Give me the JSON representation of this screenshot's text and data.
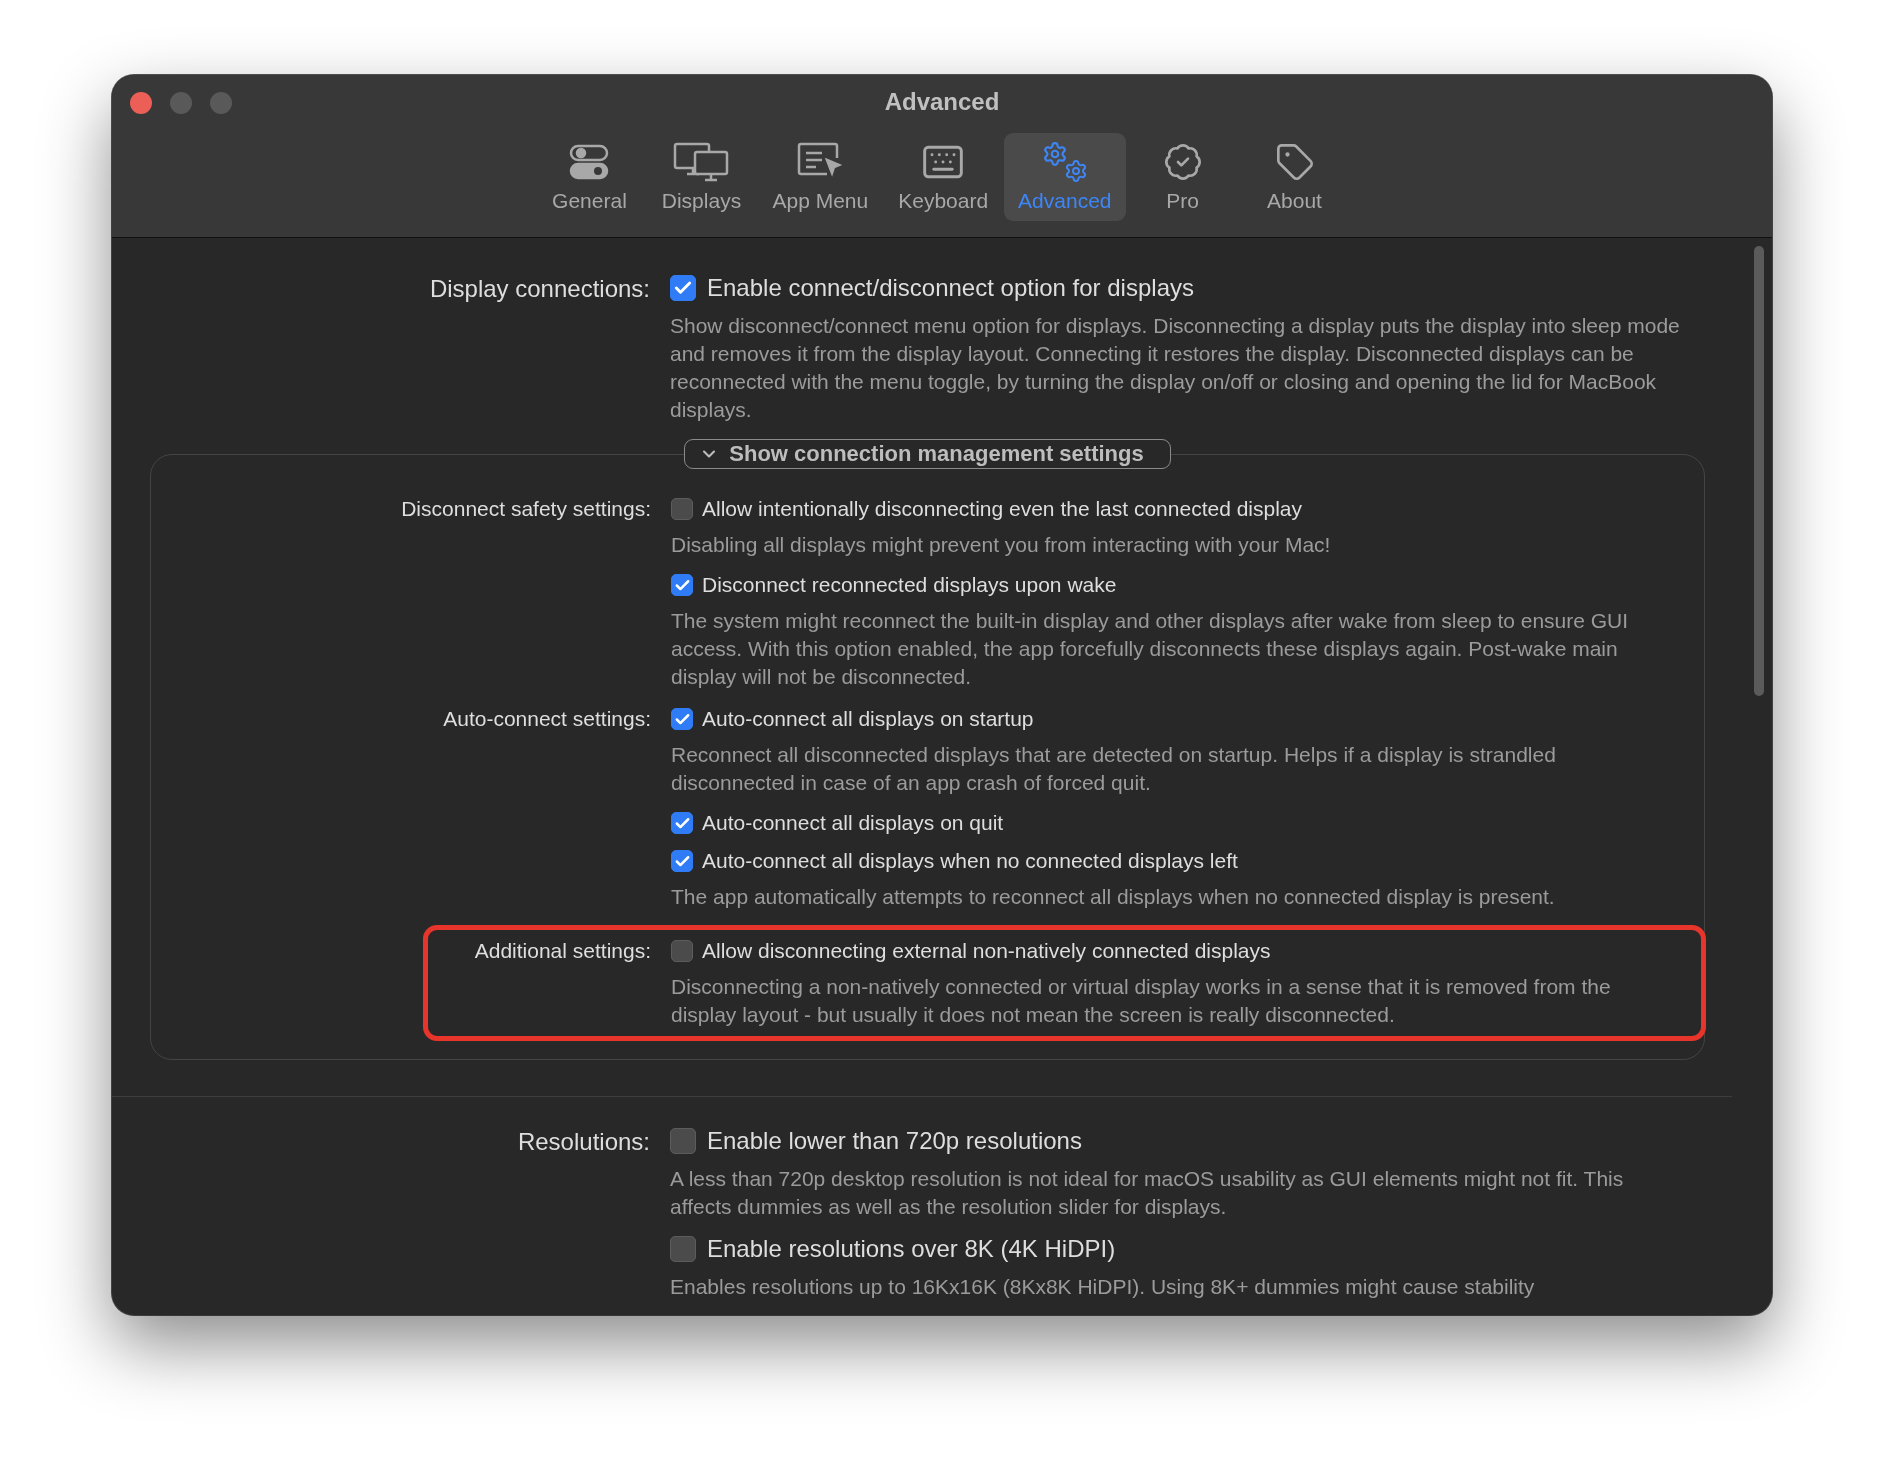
{
  "window": {
    "title": "Advanced"
  },
  "tabs": [
    {
      "label": "General",
      "kind": "toggles",
      "selected": false
    },
    {
      "label": "Displays",
      "kind": "displays",
      "selected": false
    },
    {
      "label": "App Menu",
      "kind": "menu",
      "selected": false
    },
    {
      "label": "Keyboard",
      "kind": "keyboard",
      "selected": false
    },
    {
      "label": "Advanced",
      "kind": "gears",
      "selected": true
    },
    {
      "label": "Pro",
      "kind": "badge",
      "selected": false
    },
    {
      "label": "About",
      "kind": "tag",
      "selected": false
    }
  ],
  "display_connections": {
    "label": "Display connections:",
    "options": [
      {
        "label": "Enable connect/disconnect option for displays",
        "checked": true,
        "description": "Show disconnect/connect menu option for displays. Disconnecting a display puts the display into sleep mode and removes it from the display layout. Connecting it restores the display. Disconnected displays can be reconnected with the menu toggle, by turning the display on/off or closing and opening the lid for MacBook displays."
      }
    ]
  },
  "connection_management": {
    "label": "Show connection management settings",
    "expanded": true,
    "groups": [
      {
        "label": "Disconnect safety settings:",
        "highlighted": false,
        "options": [
          {
            "label": "Allow intentionally disconnecting even the last connected display",
            "checked": false,
            "description": "Disabling all displays might prevent you from interacting with your Mac!"
          },
          {
            "label": "Disconnect reconnected displays upon wake",
            "checked": true,
            "description": "The system might reconnect the built-in display and other displays after wake from sleep to ensure GUI access. With this option enabled, the app forcefully disconnects these displays again. Post-wake main display will not be disconnected."
          }
        ]
      },
      {
        "label": "Auto-connect settings:",
        "highlighted": false,
        "options": [
          {
            "label": "Auto-connect all displays on startup",
            "checked": true,
            "description": "Reconnect all disconnected displays that are detected on startup. Helps if a display is strandled disconnected in case of an app crash of forced quit."
          },
          {
            "label": "Auto-connect all displays on quit",
            "checked": true
          },
          {
            "label": "Auto-connect all displays when no connected displays left",
            "checked": true,
            "description": "The app automatically attempts to reconnect all displays when no connected display is present."
          }
        ]
      },
      {
        "label": "Additional settings:",
        "highlighted": true,
        "options": [
          {
            "label": "Allow disconnecting external non-natively connected displays",
            "checked": false,
            "description": "Disconnecting a non-natively connected or virtual display works in a sense that it is removed from the display layout - but usually it does not mean the screen is really disconnected."
          }
        ]
      }
    ]
  },
  "resolutions": {
    "label": "Resolutions:",
    "options": [
      {
        "label": "Enable lower than 720p resolutions",
        "checked": false,
        "description": "A less than 720p desktop resolution is not ideal for macOS usability as GUI elements might not fit. This affects dummies as well as the resolution slider for displays."
      },
      {
        "label": "Enable resolutions over 8K (4K HiDPI)",
        "checked": false,
        "description": "Enables resolutions up to 16Kx16K (8Kx8K HiDPI). Using 8K+ dummies might cause stability"
      }
    ]
  }
}
